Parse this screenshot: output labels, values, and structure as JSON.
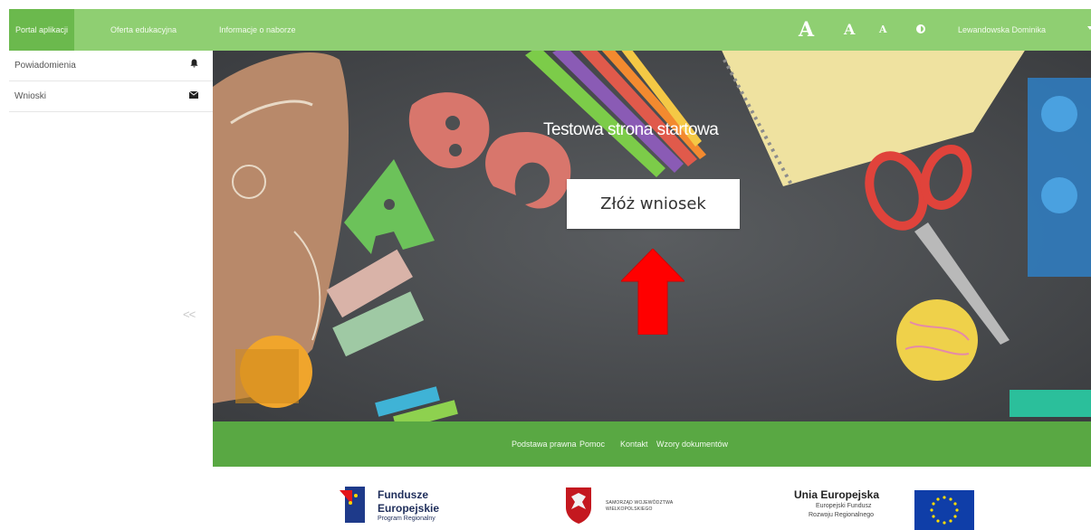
{
  "topbar": {
    "tabs": [
      {
        "label": "Portal aplikacji",
        "active": true
      },
      {
        "label": "Oferta edukacyjna",
        "active": false
      },
      {
        "label": "Informacje o naborze",
        "active": false
      }
    ],
    "font_sizes": [
      "A",
      "A",
      "A"
    ],
    "user_name": "Lewandowska Dominika"
  },
  "sidebar": {
    "items": [
      {
        "label": "Powiadomienia",
        "icon": "bell-icon"
      },
      {
        "label": "Wnioski",
        "icon": "envelope-icon"
      }
    ],
    "collapse_label": "<<"
  },
  "hero": {
    "title": "Testowa strona startowa",
    "button_label": "Złóż wniosek"
  },
  "footer": {
    "links": [
      "Podstawa prawna",
      "Pomoc",
      "Kontakt",
      "Wzory dokumentów"
    ]
  },
  "logos": {
    "fe_line1": "Fundusze",
    "fe_line2": "Europejskie",
    "fe_line3": "Program Regionalny",
    "samorzad_line1": "SAMORZĄD WOJEWÓDZTWA",
    "samorzad_line2": "WIELKOPOLSKIEGO",
    "ue_title": "Unia Europejska",
    "ue_line1": "Europejski Fundusz",
    "ue_line2": "Rozwoju Regionalnego"
  },
  "colors": {
    "topbar": "#8fcf72",
    "topbar_active": "#6bb94d",
    "footer_bar": "#59a843",
    "arrow": "#ff0000"
  }
}
